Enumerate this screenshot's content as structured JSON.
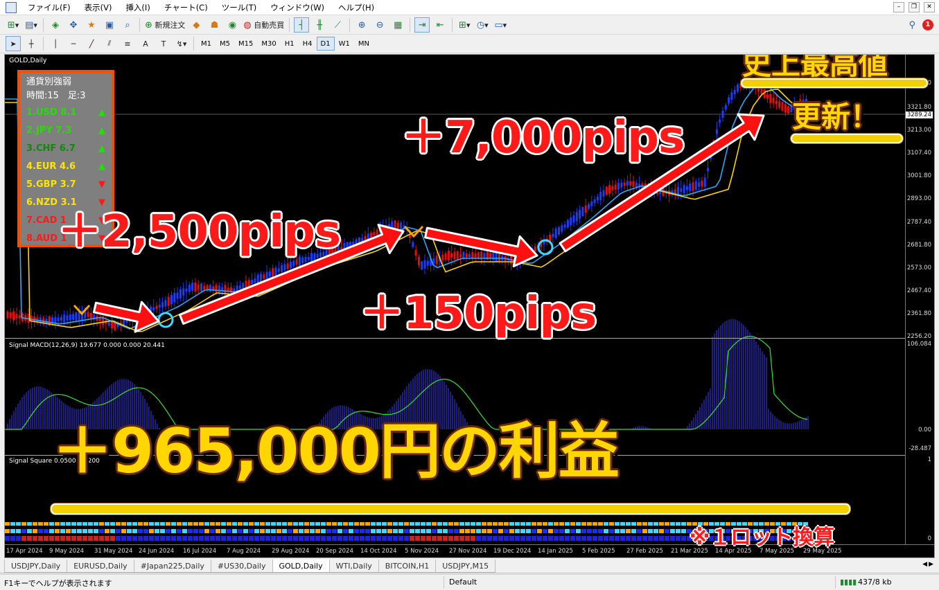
{
  "menu": {
    "items": [
      "ファイル(F)",
      "表示(V)",
      "挿入(I)",
      "チャート(C)",
      "ツール(T)",
      "ウィンドウ(W)",
      "ヘルプ(H)"
    ]
  },
  "toolbar": {
    "new_order": "新規注文",
    "auto_trade": "自動売買",
    "timeframes": [
      "M1",
      "M5",
      "M15",
      "M30",
      "H1",
      "H4",
      "D1",
      "W1",
      "MN"
    ],
    "active_timeframe": "D1",
    "draw_labels": [
      "A",
      "T"
    ],
    "notification_count": "1"
  },
  "chart": {
    "title": "GOLD,Daily",
    "prices": [
      "3321.80",
      "3213.00",
      "3107.40",
      "3001.80",
      "2893.00",
      "2787.40",
      "2681.80",
      "2573.00",
      "2467.40",
      "2361.80",
      "2256.20"
    ],
    "current_price": "3289.24",
    "top_price_fragment": "0",
    "macd_label": "Signal MACD(12,26,9) 19.677 0.000 0.000 20.441",
    "macd_scale": [
      "106.084",
      "0.00",
      "-28.487"
    ],
    "square_label": "Signal Square 0.0500 0.2200",
    "square_scale": [
      "1",
      "0"
    ],
    "dates": [
      "17 Apr 2024",
      "9 May 2024",
      "31 May 2024",
      "24 Jun 2024",
      "16 Jul 2024",
      "7 Aug 2024",
      "29 Aug 2024",
      "20 Sep 2024",
      "14 Oct 2024",
      "5 Nov 2024",
      "27 Nov 2024",
      "19 Dec 2024",
      "14 Jan 2025",
      "5 Feb 2025",
      "27 Feb 2025",
      "21 Mar 2025",
      "14 Apr 2025",
      "7 May 2025",
      "29 May 2025"
    ]
  },
  "strength_panel": {
    "title": "通貨別強弱",
    "time_label": "時間:15　足:3",
    "rows": [
      {
        "text": "1.USD 8.1",
        "color": "#22e000",
        "dir": "up"
      },
      {
        "text": "2.JPY  7.3",
        "color": "#22e000",
        "dir": "up"
      },
      {
        "text": "3.CHF  6.7",
        "color": "#0f8a0f",
        "dir": "up"
      },
      {
        "text": "4.EUR  4.6",
        "color": "#ffe400",
        "dir": "up"
      },
      {
        "text": "5.GBP  3.7",
        "color": "#ffe400",
        "dir": "down"
      },
      {
        "text": "6.NZD  3.1",
        "color": "#ffe400",
        "dir": "down"
      },
      {
        "text": "7.CAD  1",
        "color": "#ff1a1a",
        "dir": "down"
      },
      {
        "text": "8.AUD  1",
        "color": "#ff1a1a",
        "dir": "down"
      }
    ],
    "up_arrow": "▲",
    "down_arrow": "▼",
    "up_color": "#22e000",
    "down_color": "#ff1a1a"
  },
  "overlay": {
    "pips_2500": "＋2,500pips",
    "pips_7000": "＋7,000pips",
    "pips_150": "＋150pips",
    "record_line1": "史上最高値",
    "record_line2": "更新！",
    "profit": "＋965,000円の利益",
    "note": "※１ロット換算"
  },
  "tabs": {
    "items": [
      "USDJPY,Daily",
      "EURUSD,Daily",
      "#Japan225,Daily",
      "#US30,Daily",
      "GOLD,Daily",
      "WTI,Daily",
      "BITCOIN,H1",
      "USDJPY,M15"
    ],
    "active": "GOLD,Daily"
  },
  "status": {
    "help": "F1キーでヘルプが表示されます",
    "profile": "Default",
    "traffic": "437/8 kb"
  },
  "colors": {
    "bull": "#1a3cff",
    "bear": "#e01010",
    "ma_yellow": "#ffd400",
    "ma_blue": "#2aa8ff",
    "signal_cyan": "#3fd8ff",
    "signal_orange": "#ffa500",
    "arrow_red": "#ff1010"
  }
}
